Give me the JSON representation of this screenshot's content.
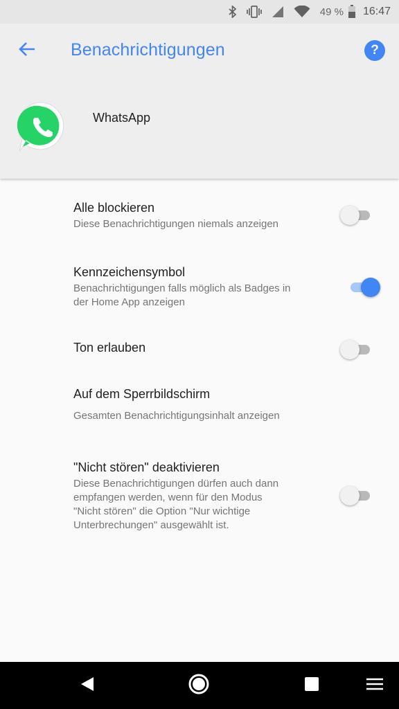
{
  "status_bar": {
    "battery_percent": "49 %",
    "time": "16:47",
    "icons": [
      "bluetooth-icon",
      "vibrate-icon",
      "cell-signal-icon",
      "wifi-icon",
      "battery-icon"
    ]
  },
  "header": {
    "title": "Benachrichtigungen",
    "back_icon": "back-arrow-icon",
    "help_icon": "help-icon",
    "help_glyph": "?"
  },
  "app": {
    "name": "WhatsApp",
    "icon": "whatsapp-icon"
  },
  "settings": [
    {
      "title": "Alle blockieren",
      "subtitle": "Diese Benachrichtigungen niemals anzeigen",
      "toggle": false
    },
    {
      "title": "Kennzeichensymbol",
      "subtitle_lines": [
        "Benachrichtigungen falls möglich als Badges in",
        "der Home App anzeigen"
      ],
      "toggle": true
    },
    {
      "title": "Ton erlauben",
      "toggle": false
    },
    {
      "title": "Auf dem Sperrbildschirm",
      "subtitle": "Gesamten Benachrichtigungsinhalt anzeigen"
    },
    {
      "title": "\"Nicht stören\" deaktivieren",
      "subtitle_lines": [
        "Diese Benachrichtigungen dürfen auch dann",
        "empfangen werden, wenn für den Modus",
        "\"Nicht stören\" die Option \"Nur wichtige",
        "Unterbrechungen\" ausgewählt ist."
      ],
      "toggle": false
    }
  ],
  "nav_bar": {
    "buttons": [
      "nav-back-icon",
      "nav-home-icon",
      "nav-recents-icon",
      "nav-menu-icon"
    ]
  },
  "colors": {
    "accent": "#4285f4",
    "whatsapp_green": "#25d366"
  }
}
